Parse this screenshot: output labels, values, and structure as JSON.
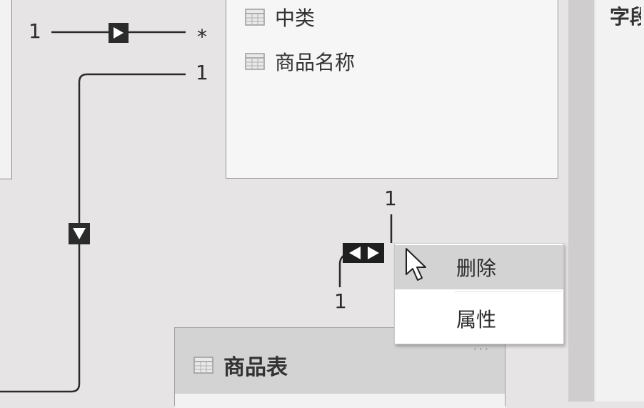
{
  "diagram": {
    "top_table": {
      "columns": [
        {
          "icon": "table-column-icon",
          "label": "中类"
        },
        {
          "icon": "table-column-icon",
          "label": "商品名称"
        }
      ]
    },
    "relationships": {
      "r1_left": "1",
      "r1_right": "*",
      "r2_right": "1",
      "r3_top": "1",
      "r3_bottom": "1"
    },
    "bottom_table": {
      "icon": "table-icon",
      "title": "商品表",
      "more": "···"
    }
  },
  "context_menu": {
    "items": [
      {
        "label": "删除",
        "state": "hover"
      },
      {
        "label": "属性",
        "state": "normal"
      }
    ]
  },
  "right_panel": {
    "partial_text": "字段"
  },
  "colors": {
    "canvas": "#e6e4e4",
    "line": "#2b2b2b",
    "menu_hover": "#d3d3d3"
  }
}
